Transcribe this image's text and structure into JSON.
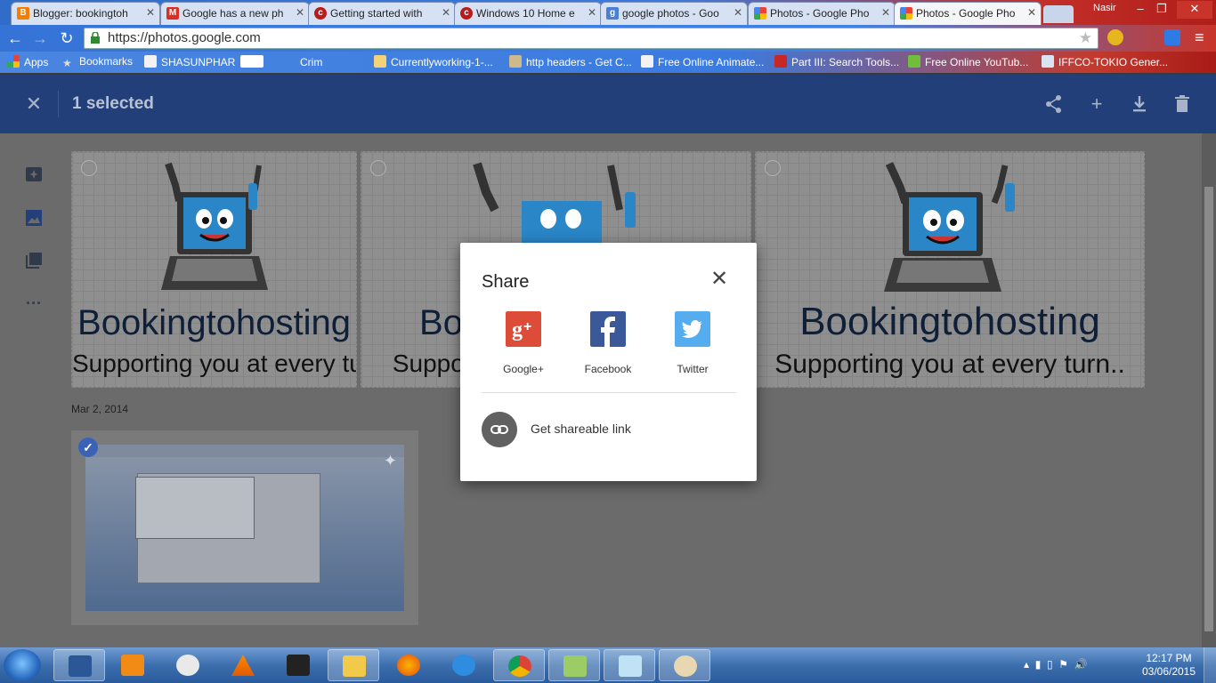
{
  "browser": {
    "tabs": [
      {
        "title": "Blogger: bookingtoh",
        "favicon": "blogger-icon",
        "color": "#f57d00"
      },
      {
        "title": "Google has a new ph",
        "favicon": "gmail-icon",
        "color": "#d93025"
      },
      {
        "title": "Getting started with",
        "favicon": "site-icon",
        "color": "#b71c1c"
      },
      {
        "title": "Windows 10 Home e",
        "favicon": "site-icon",
        "color": "#b71c1c"
      },
      {
        "title": "google photos - Goo",
        "favicon": "google-search-icon",
        "color": "#4a7fd6"
      },
      {
        "title": "Photos - Google Pho",
        "favicon": "google-photos-icon",
        "color": "#fbbc05"
      },
      {
        "title": "Photos - Google Pho",
        "favicon": "google-photos-icon",
        "color": "#fbbc05",
        "active": true
      }
    ],
    "user": "Nasir",
    "url": "https://photos.google.com",
    "bookmarks": [
      "Apps",
      "Bookmarks",
      "SHASUNPHAR",
      "Crim",
      "Currentlyworking-1-...",
      "http headers - Get C...",
      "Free Online Animate...",
      "Part III: Search Tools...",
      "Free Online YouTub...",
      "IFFCO-TOKIO Gener..."
    ]
  },
  "header": {
    "selected_label": "1 selected",
    "close_icon": "close-icon",
    "actions": [
      "share-icon",
      "add-icon",
      "download-icon",
      "delete-icon"
    ]
  },
  "sidebar": {
    "icons": [
      "assistant-icon",
      "photos-icon",
      "albums-icon",
      "more-icon"
    ]
  },
  "photos": {
    "brand": "Bookingtohosting",
    "tagline": "Supporting you at every turn..",
    "date_label": "Mar 2, 2014"
  },
  "share_dialog": {
    "title": "Share",
    "services": [
      {
        "label": "Google+",
        "color": "#dd4b39"
      },
      {
        "label": "Facebook",
        "color": "#3b5998"
      },
      {
        "label": "Twitter",
        "color": "#55acee"
      }
    ],
    "link_label": "Get shareable link"
  },
  "taskbar": {
    "apps": [
      "word-icon",
      "media-player-icon",
      "snipping-icon",
      "vlc-icon",
      "network-icon",
      "explorer-icon",
      "firefox-icon",
      "ie-icon",
      "chrome-icon",
      "notepad-plus-icon",
      "notepad-icon",
      "paint-icon"
    ],
    "time": "12:17 PM",
    "date": "03/06/2015"
  }
}
